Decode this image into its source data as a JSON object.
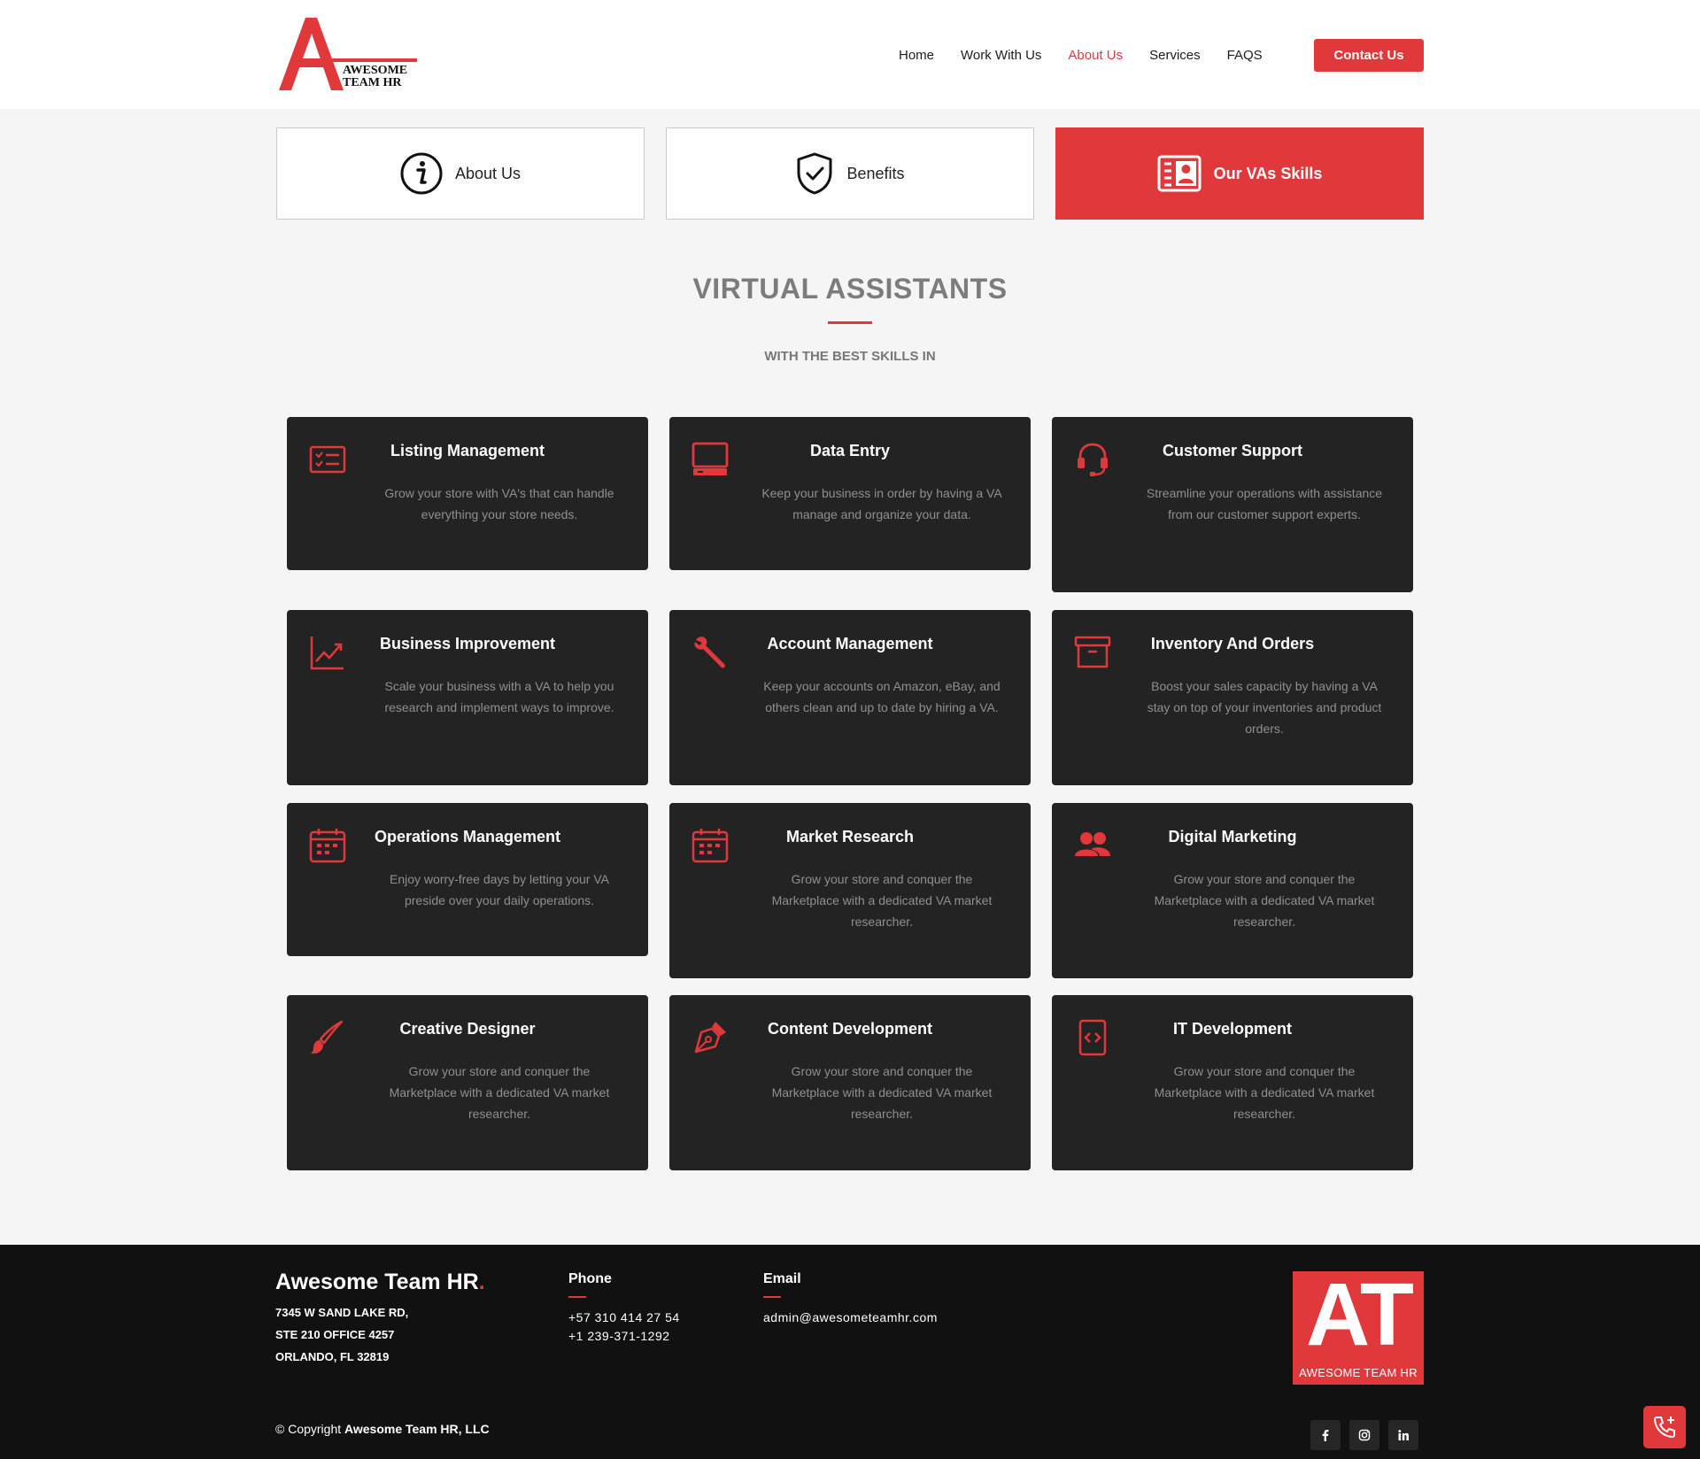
{
  "header": {
    "logo_text_line1": "AWESOME",
    "logo_text_line2": "TEAM HR",
    "nav": [
      "Home",
      "Work With Us",
      "About Us",
      "Services",
      "FAQS"
    ],
    "active_nav": "About Us",
    "contact_label": "Contact Us"
  },
  "tabs": [
    {
      "label": "About Us",
      "icon": "info-icon",
      "active": false
    },
    {
      "label": "Benefits",
      "icon": "shield-check-icon",
      "active": false
    },
    {
      "label": "Our VAs Skills",
      "icon": "id-card-icon",
      "active": true
    }
  ],
  "section": {
    "title": "VIRTUAL ASSISTANTS",
    "subtitle": "WITH THE BEST SKILLS IN"
  },
  "cards": [
    {
      "title": "Listing Management",
      "desc": "Grow your store with VA's that can handle everything your store needs.",
      "icon": "checklist-icon"
    },
    {
      "title": "Data Entry",
      "desc": "Keep your business in order by having a VA manage and organize your data.",
      "icon": "computer-icon"
    },
    {
      "title": "Customer Support",
      "desc": "Streamline your operations with assistance from our customer support experts.",
      "icon": "headset-icon"
    },
    {
      "title": "Business Improvement",
      "desc": "Scale your business with a VA to help you research and implement ways to improve.",
      "icon": "chart-line-icon"
    },
    {
      "title": "Account Management",
      "desc": "Keep your accounts on Amazon, eBay, and others clean and up to date by hiring a VA.",
      "icon": "wrench-icon"
    },
    {
      "title": "Inventory And Orders",
      "desc": "Boost your sales capacity by having a VA stay on top of your inventories and product orders.",
      "icon": "archive-box-icon"
    },
    {
      "title": "Operations Management",
      "desc": "Enjoy worry-free days by letting your VA preside over your daily operations.",
      "icon": "calendar-icon"
    },
    {
      "title": "Market Research",
      "desc": "Grow your store and conquer the Marketplace with a dedicated VA market researcher.",
      "icon": "calendar-icon"
    },
    {
      "title": "Digital Marketing",
      "desc": "Grow your store and conquer the Marketplace with a dedicated VA market researcher.",
      "icon": "users-icon"
    },
    {
      "title": "Creative Designer",
      "desc": "Grow your store and conquer the Marketplace with a dedicated VA market researcher.",
      "icon": "paintbrush-icon"
    },
    {
      "title": "Content Development",
      "desc": "Grow your store and conquer the Marketplace with a dedicated VA market researcher.",
      "icon": "pen-nib-icon"
    },
    {
      "title": "IT Development",
      "desc": "Grow your store and conquer the Marketplace with a dedicated VA market researcher.",
      "icon": "code-file-icon"
    }
  ],
  "footer": {
    "brand": "Awesome Team HR",
    "brand_dot": ".",
    "address": [
      "7345 W SAND LAKE RD,",
      "STE 210 OFFICE 4257",
      "ORLANDO, FL 32819"
    ],
    "phone_title": "Phone",
    "phones": [
      "+57 310 414 27 54",
      "+1 239-371-1292"
    ],
    "email_title": "Email",
    "email": "admin@awesometeamhr.com",
    "logo_big": "AT",
    "logo_small": "AWESOME TEAM HR",
    "copyright_prefix": "© Copyright",
    "copyright_name": "Awesome Team HR, LLC",
    "social": [
      "f",
      "ig",
      "in"
    ]
  },
  "colors": {
    "accent": "#e0383b",
    "card_bg": "#232323",
    "footer_bg": "#111111",
    "page_bg": "#f5f5f6"
  }
}
